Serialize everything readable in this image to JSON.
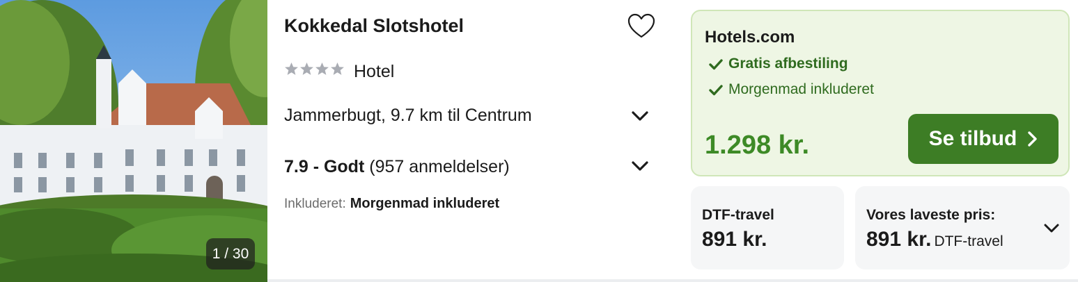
{
  "photo": {
    "counter": "1 / 30"
  },
  "hotel": {
    "name": "Kokkedal Slotshotel",
    "stars": 4,
    "type": "Hotel",
    "location": "Jammerbugt, 9.7 km til Centrum",
    "rating_score": "7.9 - Godt",
    "rating_reviews": "(957 anmeldelser)",
    "included_label": "Inkluderet:",
    "included_value": "Morgenmad inkluderet"
  },
  "offer": {
    "provider": "Hotels.com",
    "perks": [
      "Gratis afbestiling",
      "Morgenmad inkluderet"
    ],
    "price": "1.298 kr.",
    "cta_label": "Se tilbud"
  },
  "alternatives": [
    {
      "provider": "DTF-travel",
      "price": "891 kr."
    },
    {
      "label": "Vores laveste pris:",
      "price": "891 kr.",
      "provider": "DTF-travel"
    }
  ],
  "colors": {
    "offer_bg": "#eef6e4",
    "offer_border": "#cfe6b8",
    "price_green": "#3d8a26",
    "cta_green": "#3d7d25",
    "perk_green": "#2f6b1f",
    "star_gray": "#a9acb3"
  },
  "icons": {
    "favorite": "heart-outline-icon",
    "expand": "chevron-down-icon",
    "check": "check-icon",
    "cta": "chevron-right-icon"
  }
}
